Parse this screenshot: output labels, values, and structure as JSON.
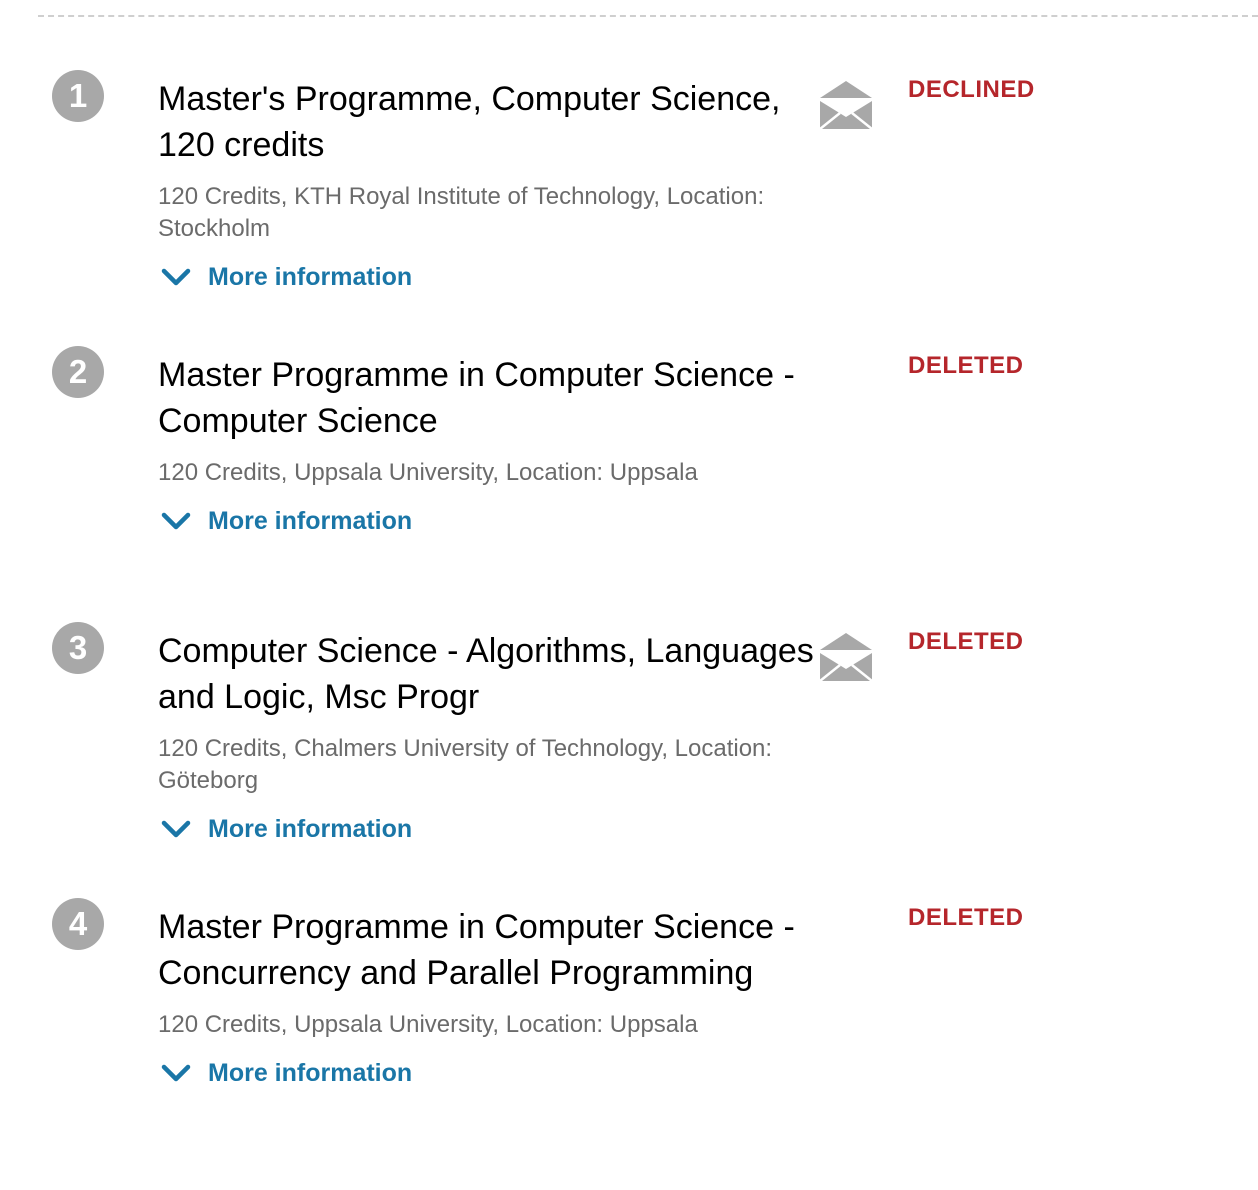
{
  "applications": [
    {
      "number": "1",
      "title": "Master's Programme, Computer Science, 120 credits",
      "details": "120 Credits, KTH Royal Institute of Technology, Location: Stockholm",
      "more_label": "More information",
      "status": "DECLINED",
      "has_message_icon": true
    },
    {
      "number": "2",
      "title": "Master Programme in Computer Science - Computer Science",
      "details": "120 Credits, Uppsala University, Location: Uppsala",
      "more_label": "More information",
      "status": "DELETED",
      "has_message_icon": false
    },
    {
      "number": "3",
      "title": "Computer Science - Algorithms, Languages and Logic, Msc Progr",
      "details": "120 Credits, Chalmers University of Technology, Location: Göteborg",
      "more_label": "More information",
      "status": "DELETED",
      "has_message_icon": true
    },
    {
      "number": "4",
      "title": "Master Programme in Computer Science - Concurrency and Parallel Programming",
      "details": "120 Credits, Uppsala University, Location: Uppsala",
      "more_label": "More information",
      "status": "DELETED",
      "has_message_icon": false
    }
  ],
  "icons": {
    "number_badge": "circle-number",
    "message": "envelope-icon",
    "expand": "chevron-down-icon"
  },
  "colors": {
    "status": "#b5262b",
    "link": "#1a76a7",
    "badge": "#a8a8a8",
    "meta_text": "#6b6b6b",
    "icon": "#a8a8a8"
  }
}
